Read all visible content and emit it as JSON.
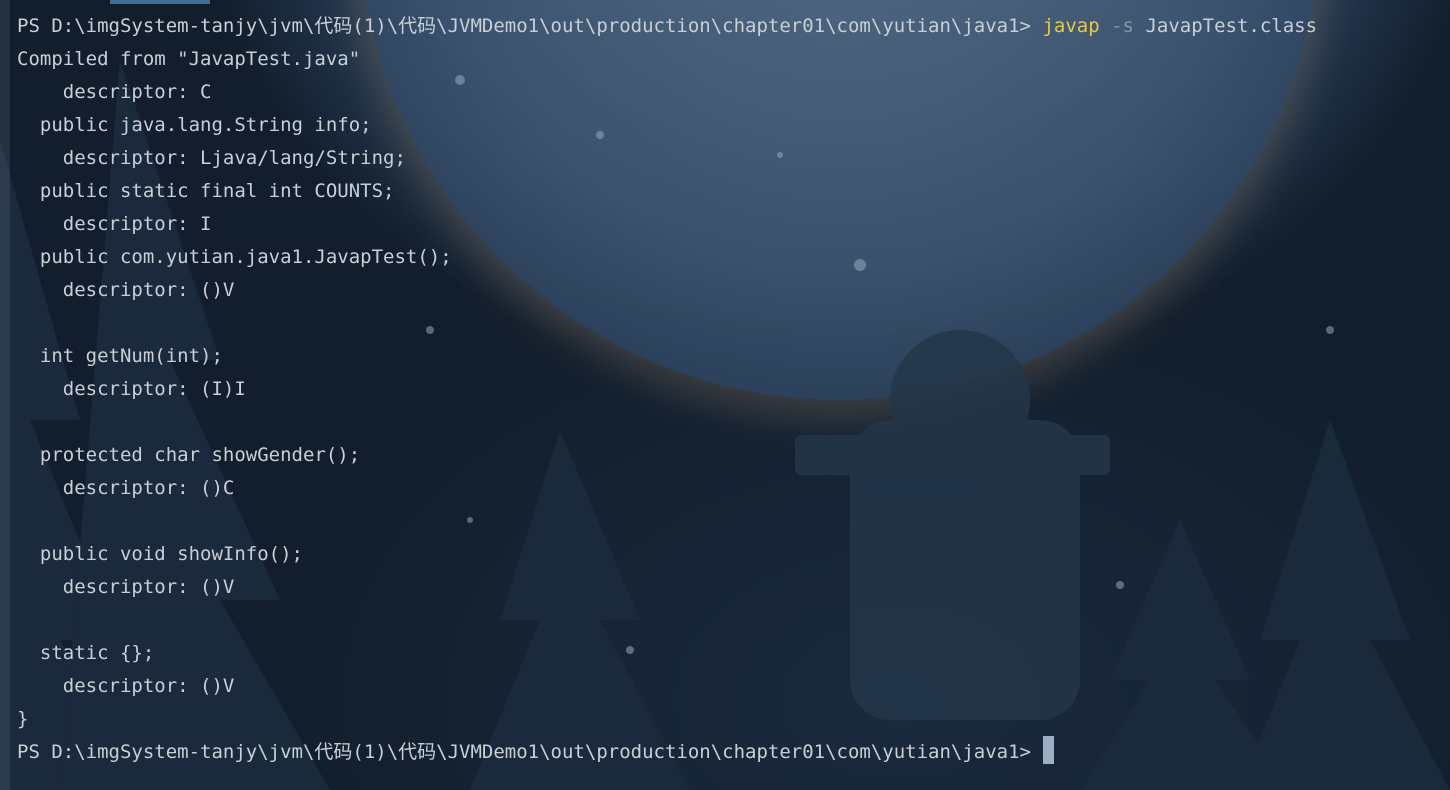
{
  "terminal": {
    "prompt": "PS D:\\imgSystem-tanjy\\jvm\\代码(1)\\代码\\JVMDemo1\\out\\production\\chapter01\\com\\yutian\\java1>",
    "command": {
      "name": "javap",
      "flag": "-s",
      "argument": "JavapTest.class"
    },
    "output": [
      "Compiled from \"JavapTest.java\"",
      "    descriptor: C",
      "  public java.lang.String info;",
      "    descriptor: Ljava/lang/String;",
      "  public static final int COUNTS;",
      "    descriptor: I",
      "  public com.yutian.java1.JavapTest();",
      "    descriptor: ()V",
      "",
      "  int getNum(int);",
      "    descriptor: (I)I",
      "",
      "  protected char showGender();",
      "    descriptor: ()C",
      "",
      "  public void showInfo();",
      "    descriptor: ()V",
      "",
      "  static {};",
      "    descriptor: ()V",
      "}"
    ],
    "colors": {
      "command": "#e6c84a",
      "flag": "#8a96a3",
      "text": "#c9cfd6"
    }
  }
}
